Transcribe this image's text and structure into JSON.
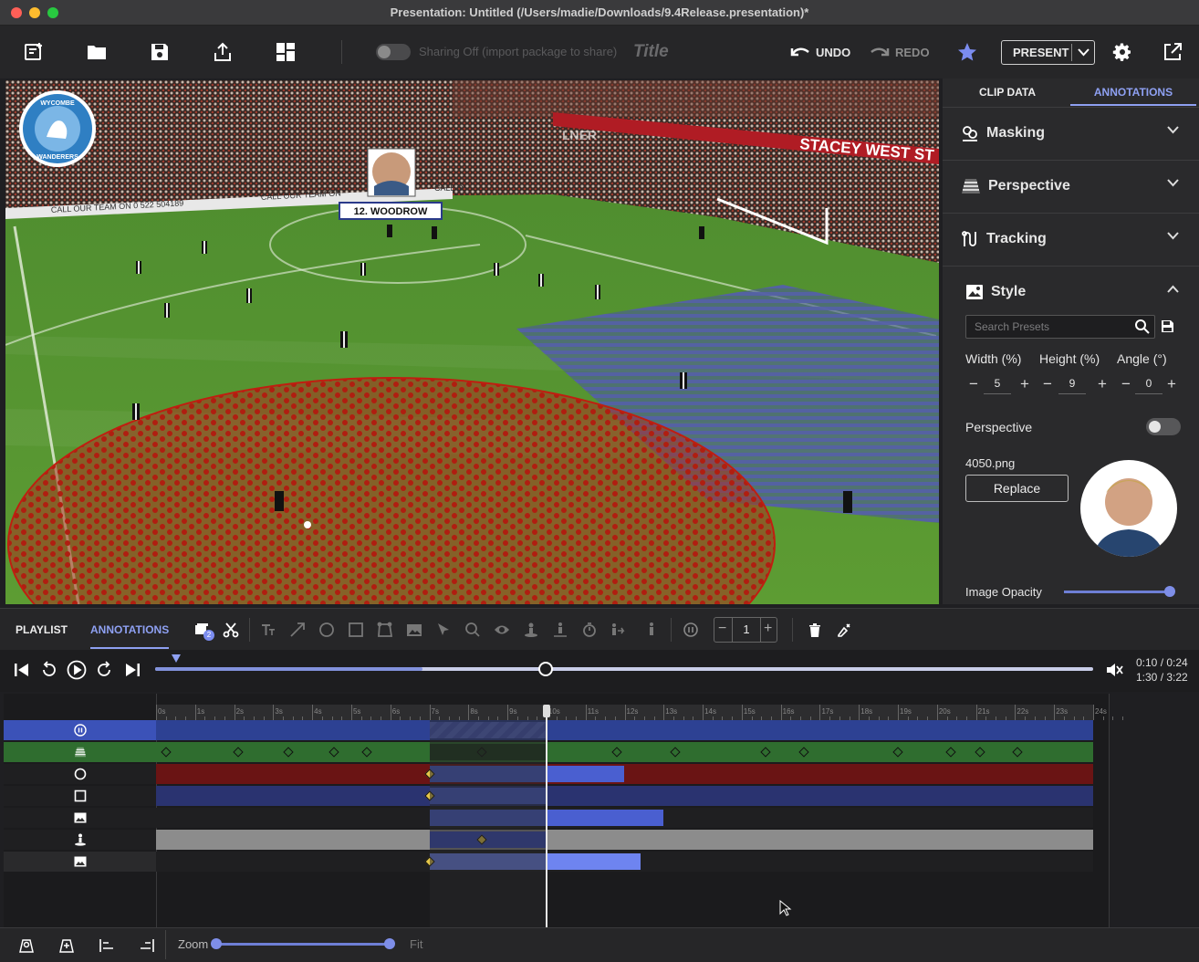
{
  "window": {
    "title": "Presentation: Untitled (/Users/madie/Downloads/9.4Release.presentation)*"
  },
  "toolbar": {
    "sharing_label": "Sharing Off (import package to share)",
    "title_placeholder": "Title",
    "undo_label": "UNDO",
    "redo_label": "REDO",
    "present_label": "PRESENT"
  },
  "video": {
    "club_badge_top": "WYCOMBE",
    "club_badge_bottom": "WANDERERS",
    "player_tag": "12. WOODROW",
    "board_text_1": "STACEY WEST ST",
    "board_text_2": "CALL OUR TEAM ON 0 522 504189",
    "board_text_3": "CALL OUR TEAM ON",
    "board_text_4": "CALL O",
    "board_text_5": "LNER"
  },
  "right_panel": {
    "tabs": [
      "CLIP DATA",
      "ANNOTATIONS"
    ],
    "active_tab": "ANNOTATIONS",
    "sections": [
      {
        "label": "Masking",
        "icon": "masking-icon",
        "expanded": false
      },
      {
        "label": "Perspective",
        "icon": "perspective-icon",
        "expanded": false
      },
      {
        "label": "Tracking",
        "icon": "tracking-icon",
        "expanded": false
      },
      {
        "label": "Style",
        "icon": "image-icon",
        "expanded": true
      }
    ],
    "style": {
      "search_placeholder": "Search Presets",
      "width_label": "Width (%)",
      "height_label": "Height (%)",
      "angle_label": "Angle (°)",
      "width_value": "5",
      "height_value": "9",
      "angle_value": "0",
      "perspective_label": "Perspective",
      "perspective_on": false,
      "file_name": "4050.png",
      "replace_label": "Replace",
      "opacity_label": "Image Opacity",
      "opacity": 1.0
    }
  },
  "bottom_tabs": {
    "tabs": [
      "PLAYLIST",
      "ANNOTATIONS"
    ],
    "active": "ANNOTATIONS",
    "badge": "2",
    "step_value": "1"
  },
  "transport": {
    "time_current": "0:10 / 0:24",
    "time_total": "1:30 / 3:22",
    "progress": 0.4167
  },
  "timeline": {
    "ticks": [
      "0s",
      "1s",
      "2s",
      "3s",
      "4s",
      "5s",
      "6s",
      "7s",
      "8s",
      "9s",
      "10s",
      "11s",
      "12s",
      "13s",
      "14s",
      "15s",
      "16s",
      "17s",
      "18s",
      "19s",
      "20s",
      "21s",
      "22s",
      "23s",
      "24s"
    ],
    "playhead_s": 10.0,
    "rows": [
      {
        "name": "pause",
        "icon": "pause-icon",
        "color": "#2d4193"
      },
      {
        "name": "perspective",
        "icon": "perspective-icon",
        "color": "#2f6d2f"
      },
      {
        "name": "circle",
        "icon": "circle-icon",
        "color": "#6a1414"
      },
      {
        "name": "square",
        "icon": "square-icon",
        "color": "#2a3370"
      },
      {
        "name": "image",
        "icon": "image-icon",
        "color": "#1f1f21"
      },
      {
        "name": "spotlight",
        "icon": "spotlight-icon",
        "color": "#8c8c8c"
      },
      {
        "name": "image-2",
        "icon": "image-icon",
        "color": "#1f1f21"
      }
    ]
  },
  "footer": {
    "zoom_label": "Zoom",
    "fit_label": "Fit",
    "zoom_level": 0.98
  }
}
